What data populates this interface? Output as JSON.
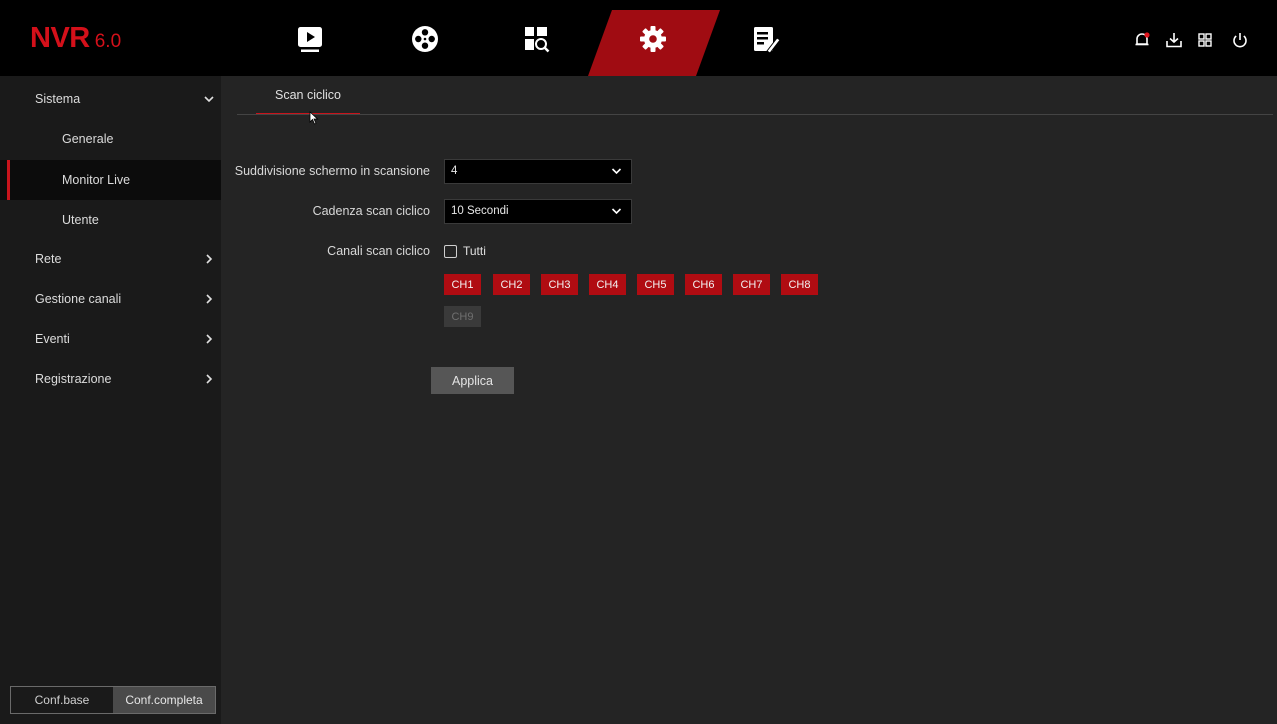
{
  "app": {
    "logo_main": "NVR",
    "logo_version": "6.0"
  },
  "topnav": {
    "items": [
      {
        "name": "playback-icon"
      },
      {
        "name": "film-reel-icon"
      },
      {
        "name": "search-layout-icon"
      },
      {
        "name": "gear-icon",
        "active": true
      },
      {
        "name": "maintenance-icon"
      }
    ],
    "active_color": "#a00c12",
    "sys_icons": [
      "alarm-bell-icon",
      "download-icon",
      "multi-screen-icon",
      "power-icon"
    ]
  },
  "sidebar": {
    "items": [
      {
        "label": "Sistema"
      },
      {
        "label": "Generale"
      },
      {
        "label": "Monitor Live"
      },
      {
        "label": "Utente"
      },
      {
        "label": "Rete"
      },
      {
        "label": "Gestione canali"
      },
      {
        "label": "Eventi"
      },
      {
        "label": "Registrazione"
      }
    ],
    "mode": {
      "basic": "Conf.base",
      "full": "Conf.completa"
    }
  },
  "main": {
    "tab": "Scan ciclico",
    "fields": {
      "split_label": "Suddivisione schermo in scansione",
      "split_value": "4",
      "cadence_label": "Cadenza scan ciclico",
      "cadence_value": "10 Secondi",
      "channels_label": "Canali scan ciclico",
      "all_label": "Tutti"
    },
    "channels": [
      "CH1",
      "CH2",
      "CH3",
      "CH4",
      "CH5",
      "CH6",
      "CH7",
      "CH8",
      "CH9"
    ],
    "apply_label": "Applica"
  },
  "colors": {
    "accent": "#c8141c",
    "channel_selected": "#b00c12",
    "channel_disabled": "#3a3a3a"
  }
}
